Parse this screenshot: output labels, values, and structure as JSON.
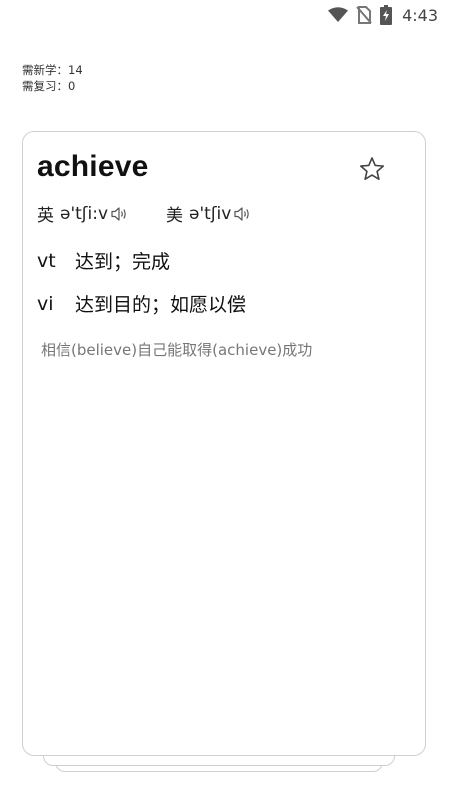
{
  "status_bar": {
    "time": "4:43",
    "icons": [
      "wifi-icon",
      "no-sim-icon",
      "battery-charging-icon"
    ]
  },
  "counters": {
    "new_label": "需新学：14",
    "review_label": "需复习：0"
  },
  "card": {
    "word": "achieve",
    "favorite_icon": "star-outline-icon",
    "pron_uk": {
      "label": "英",
      "ipa": "ə'tʃi:v",
      "icon": "speaker-icon"
    },
    "pron_us": {
      "label": "美",
      "ipa": "ə'tʃiv",
      "icon": "speaker-icon"
    },
    "definitions": [
      {
        "pos": "vt",
        "meaning": "达到；完成"
      },
      {
        "pos": "vi",
        "meaning": "达到目的；如愿以偿"
      }
    ],
    "mnemonic": "相信(believe)自己能取得(achieve)成功"
  },
  "colors": {
    "card_border": "#cfcfcf",
    "text_primary": "#111111",
    "text_secondary": "#777777",
    "status_icons": "#555555"
  }
}
